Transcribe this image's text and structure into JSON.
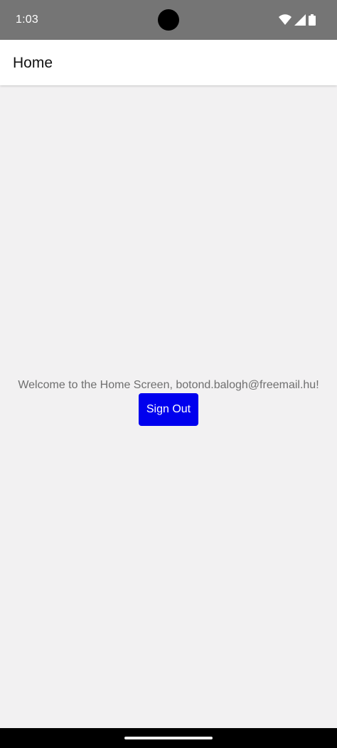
{
  "status_bar": {
    "time": "1:03",
    "icons": [
      "wifi-icon",
      "cell-signal-icon",
      "battery-icon"
    ]
  },
  "app_bar": {
    "title": "Home"
  },
  "main": {
    "welcome_text": "Welcome to the Home Screen, botond.balogh@freemail.hu!",
    "sign_out_label": "Sign Out"
  },
  "colors": {
    "status_bar_bg": "#757575",
    "screen_bg": "#f2f1f2",
    "button_bg": "#0000ee",
    "welcome_text": "#6f6f6f",
    "nav_bar_bg": "#000000"
  }
}
